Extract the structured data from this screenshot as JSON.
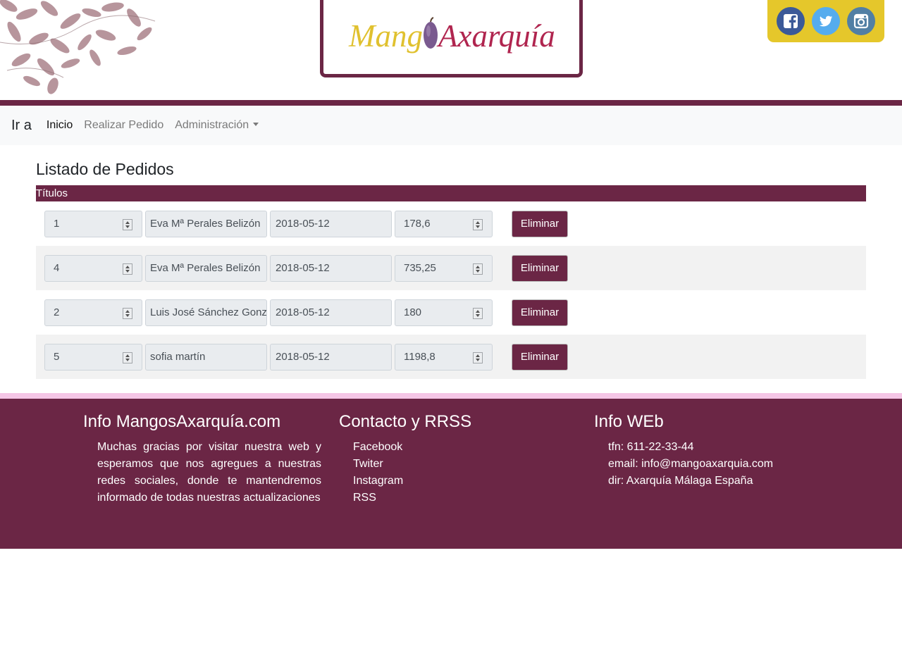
{
  "header": {
    "logo": {
      "part1": "Mang",
      "part2": "Axarquía"
    },
    "social": [
      {
        "name": "Facebook",
        "icon": "facebook-icon",
        "color": "#3b5998"
      },
      {
        "name": "Twitter",
        "icon": "twitter-icon",
        "color": "#55acee"
      },
      {
        "name": "Instagram",
        "icon": "instagram-icon",
        "color": "#517fa4"
      }
    ]
  },
  "colors": {
    "brand": "#6b2645",
    "social_bg": "#e5c72b",
    "footer_band": "#f5c6e6"
  },
  "navbar": {
    "brand": "Ir a",
    "links": [
      {
        "label": "Inicio"
      },
      {
        "label": "Realizar Pedido"
      },
      {
        "label": "Administración"
      }
    ]
  },
  "main": {
    "title": "Listado de Pedidos",
    "table_header": "Títulos",
    "delete_label": "Eliminar",
    "rows": [
      {
        "id": "1",
        "name": "Eva Mª Perales Belizón",
        "date": "2018-05-12",
        "total": "178,6"
      },
      {
        "id": "4",
        "name": "Eva Mª Perales Belizón",
        "date": "2018-05-12",
        "total": "735,25"
      },
      {
        "id": "2",
        "name": "Luis José Sánchez Gonz",
        "date": "2018-05-12",
        "total": "180"
      },
      {
        "id": "5",
        "name": "sofia martín",
        "date": "2018-05-12",
        "total": "1198,8"
      }
    ]
  },
  "footer": {
    "info": {
      "title": "Info MangosAxarquía.com",
      "text": "Muchas gracias por visitar nuestra web y esperamos que nos agregues a nuestras redes sociales, donde te mantendremos informado de todas nuestras actualizaciones"
    },
    "contact": {
      "title": "Contacto y RRSS",
      "links": [
        "Facebook",
        "Twiter",
        "Instagram",
        "RSS"
      ]
    },
    "web": {
      "title": "Info WEb",
      "lines": [
        "tfn: 611-22-33-44",
        "email: info@mangoaxarquia.com",
        "dir: Axarquía Málaga España"
      ]
    }
  }
}
